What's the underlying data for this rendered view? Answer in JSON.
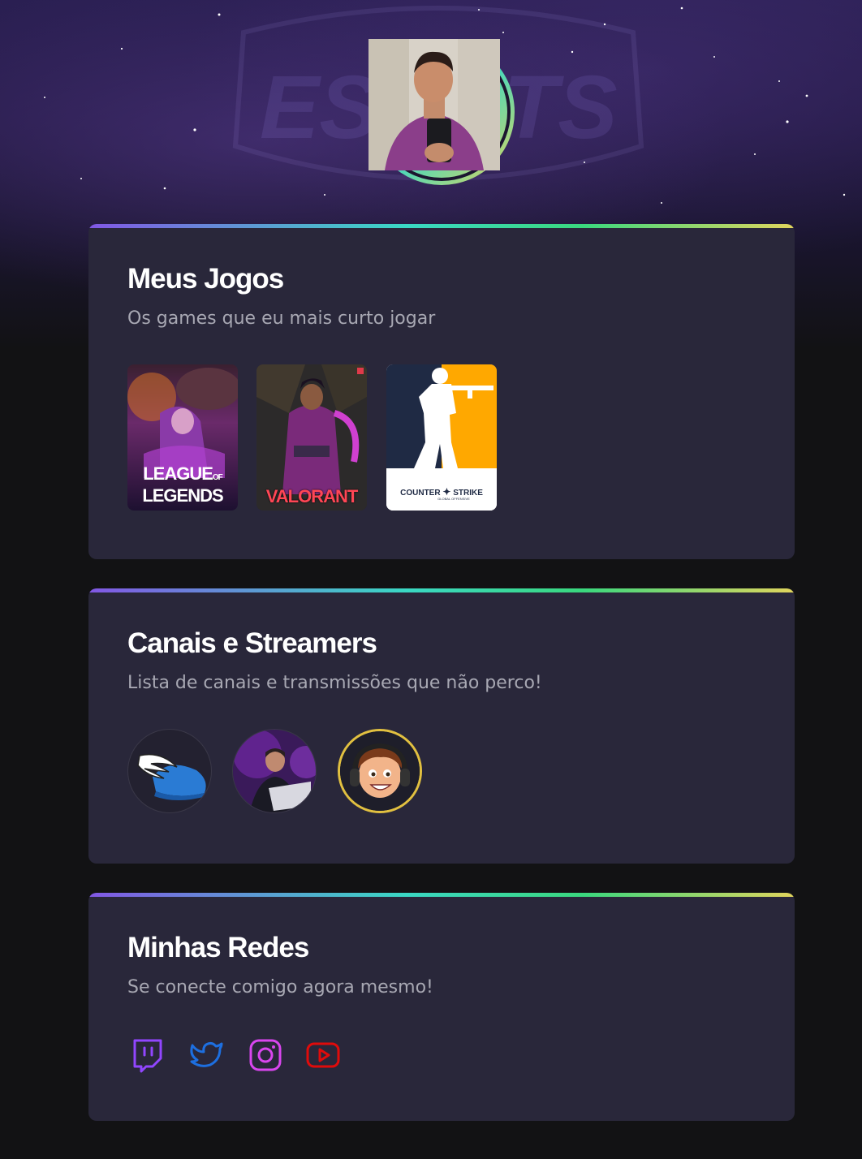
{
  "profile": {
    "avatar_alt": "Foto de perfil"
  },
  "sections": {
    "games": {
      "title": "Meus Jogos",
      "subtitle": "Os games que eu mais curto jogar",
      "items": [
        {
          "name": "League of Legends",
          "line1": "LEAGUE",
          "of": "OF",
          "line2": "LEGENDS"
        },
        {
          "name": "Valorant",
          "label": "VALORANT"
        },
        {
          "name": "Counter-Strike",
          "label_left": "COUNTER",
          "label_right": "STRIKE",
          "label_sub": "GLOBAL OFFENSIVE"
        }
      ]
    },
    "streamers": {
      "title": "Canais e Streamers",
      "subtitle": "Lista de canais e transmissões que não perco!",
      "items": [
        {
          "icon": "winged-helmet-icon"
        },
        {
          "icon": "streamer-photo"
        },
        {
          "icon": "cartoon-avatar-icon"
        }
      ]
    },
    "social": {
      "title": "Minhas Redes",
      "subtitle": "Se conecte comigo agora mesmo!",
      "items": [
        {
          "icon": "twitch-icon",
          "color": "#9146ff"
        },
        {
          "icon": "twitter-icon",
          "color": "#1d6fe0"
        },
        {
          "icon": "instagram-icon",
          "color": "#d946ef"
        },
        {
          "icon": "youtube-icon",
          "color": "#e00b0b"
        }
      ]
    }
  },
  "colors": {
    "background": "#121214",
    "card": "#29273a",
    "gradient": [
      "#8257e5",
      "#3ad8c4",
      "#e1d55d"
    ],
    "subtitle": "#a8a8b3"
  }
}
